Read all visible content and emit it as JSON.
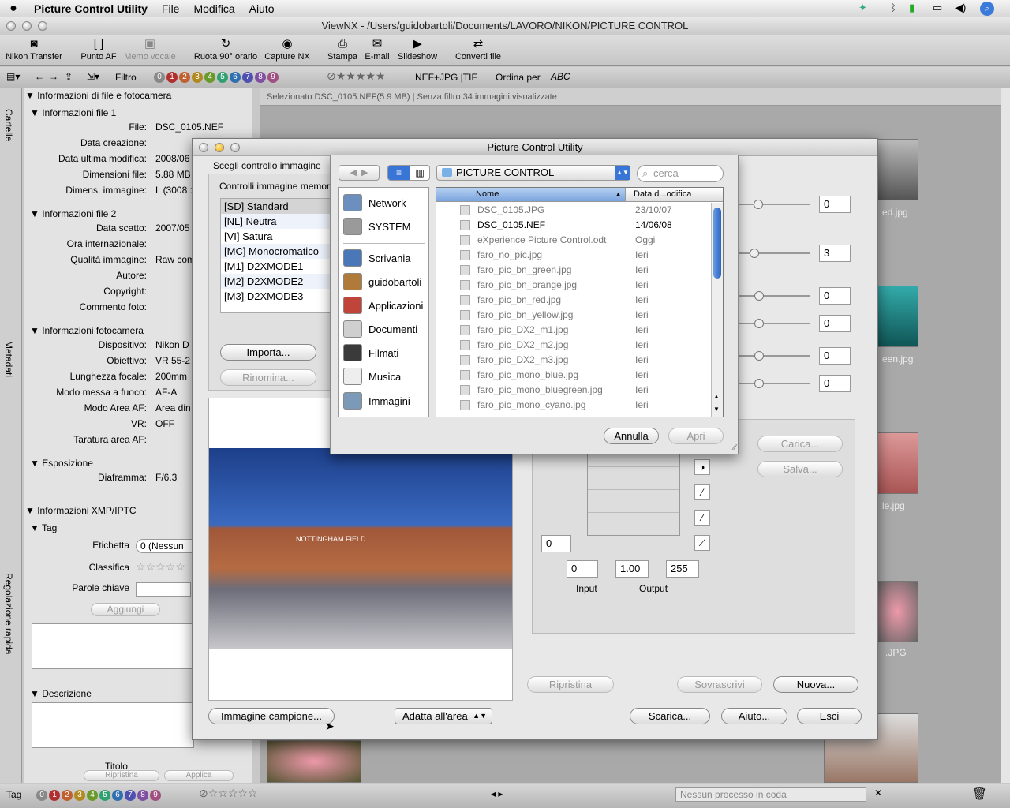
{
  "menubar": {
    "apple": "",
    "app": "Picture Control Utility",
    "items": [
      "File",
      "Modifica",
      "Aiuto"
    ]
  },
  "window": {
    "title": "ViewNX - /Users/guidobartoli/Documents/LAVORO/NIKON/PICTURE CONTROL"
  },
  "toolbar": {
    "items": [
      {
        "label": "Nikon Transfer",
        "icon": "camera-icon"
      },
      {
        "label": "Punto AF",
        "icon": "af-point-icon"
      },
      {
        "label": "Memo vocale",
        "icon": "voice-memo-icon"
      },
      {
        "label": "Ruota 90° orario",
        "icon": "rotate-icon"
      },
      {
        "label": "Capture NX",
        "icon": "capture-nx-icon"
      },
      {
        "label": "Stampa",
        "icon": "print-icon"
      },
      {
        "label": "E-mail",
        "icon": "mail-icon"
      },
      {
        "label": "Slideshow",
        "icon": "slideshow-icon"
      },
      {
        "label": "Converti file",
        "icon": "convert-icon"
      }
    ]
  },
  "filterbar": {
    "filtro": "Filtro",
    "dots": [
      "0",
      "1",
      "2",
      "3",
      "4",
      "5",
      "6",
      "7",
      "8",
      "9"
    ],
    "format": "NEF+JPG |TIF",
    "sort": "Ordina per",
    "sort_icon": "ABC"
  },
  "lefttabs": {
    "cartelle": "Cartelle",
    "metadati": "Metadati",
    "regolazione": "Regolazione rapida"
  },
  "info": {
    "header": "Informazioni di file e fotocamera",
    "file1": "Informazioni file 1",
    "file1_rows": [
      {
        "k": "File:",
        "v": "DSC_0105.NEF"
      },
      {
        "k": "Data creazione:",
        "v": ""
      },
      {
        "k": "Data ultima modifica:",
        "v": "2008/06"
      },
      {
        "k": "Dimensioni file:",
        "v": "5.88 MB"
      },
      {
        "k": "Dimens. immagine:",
        "v": "L (3008 :"
      }
    ],
    "file2": "Informazioni file 2",
    "file2_rows": [
      {
        "k": "Data scatto:",
        "v": "2007/05"
      },
      {
        "k": "Ora internazionale:",
        "v": ""
      },
      {
        "k": "Qualità immagine:",
        "v": "Raw com"
      },
      {
        "k": "Autore:",
        "v": ""
      },
      {
        "k": "Copyright:",
        "v": ""
      },
      {
        "k": "Commento foto:",
        "v": ""
      }
    ],
    "camera": "Informazioni fotocamera",
    "camera_rows": [
      {
        "k": "Dispositivo:",
        "v": "Nikon D"
      },
      {
        "k": "Obiettivo:",
        "v": "VR 55-2"
      },
      {
        "k": "Lunghezza focale:",
        "v": "200mm"
      },
      {
        "k": "Modo messa a fuoco:",
        "v": "AF-A"
      },
      {
        "k": "Modo Area AF:",
        "v": "Area din"
      },
      {
        "k": "VR:",
        "v": "OFF"
      },
      {
        "k": "Taratura area AF:",
        "v": ""
      }
    ],
    "exposure": "Esposizione",
    "exposure_rows": [
      {
        "k": "Diaframma:",
        "v": "F/6.3"
      }
    ]
  },
  "xmp": {
    "header": "Informazioni XMP/IPTC",
    "tag": "Tag",
    "etichetta": "Etichetta",
    "etichetta_value": "(Nessun",
    "etichetta_num": "0",
    "classifica": "Classifica",
    "parole": "Parole chiave",
    "aggiungi": "Aggiungi",
    "descrizione": "Descrizione",
    "titolo": "Titolo",
    "ripristina": "Ripristina",
    "applica": "Applica"
  },
  "main": {
    "header": "Selezionato:DSC_0105.NEF(5.9 MB) | Senza filtro:34 immagini visualizzate",
    "captions": [
      "ed.jpg",
      "een.jpg",
      "le.jpg",
      ".JPG"
    ]
  },
  "bottombar": {
    "tag": "Tag",
    "queue": "Nessun processo in coda"
  },
  "dialog": {
    "title": "Picture Control Utility",
    "choose": "Scegli controllo immagine",
    "memory": "Controlli immagine memor",
    "controls": [
      "[SD] Standard",
      "[NL] Neutra",
      "[VI] Satura",
      "[MC] Monocromatico",
      "[M1] D2XMODE1",
      "[M2] D2XMODE2",
      "[M3] D2XMODE3"
    ],
    "importa": "Importa...",
    "rinomina": "Rinomina...",
    "values": [
      "0",
      "3",
      "0",
      "0",
      "0",
      "0"
    ],
    "carica": "Carica...",
    "salva": "Salva...",
    "curve_field": "0",
    "input_val": "0",
    "gamma_val": "1.00",
    "output_val": "255",
    "input_label": "Input",
    "output_label": "Output",
    "ripristina": "Ripristina",
    "sovrascrivi": "Sovrascrivi",
    "nuova": "Nuova...",
    "campione": "Immagine campione...",
    "adatta": "Adatta all'area",
    "scarica": "Scarica...",
    "aiuto": "Aiuto...",
    "esci": "Esci",
    "photo_sign": "NOTTINGHAM FIELD"
  },
  "sheet": {
    "location": "PICTURE CONTROL",
    "search_placeholder": "cerca",
    "sidebar": [
      {
        "label": "Network",
        "icon": "network-icon",
        "color": "#6d8fc0"
      },
      {
        "label": "SYSTEM",
        "icon": "disk-icon",
        "color": "#9a9a9a"
      },
      {
        "label": "Scrivania",
        "icon": "desktop-icon",
        "color": "#4a77b8"
      },
      {
        "label": "guidobartoli",
        "icon": "home-icon",
        "color": "#b07a3a"
      },
      {
        "label": "Applicazioni",
        "icon": "applications-icon",
        "color": "#c0443a"
      },
      {
        "label": "Documenti",
        "icon": "documents-icon",
        "color": "#cfcfcf"
      },
      {
        "label": "Filmati",
        "icon": "movies-icon",
        "color": "#3a3a3a"
      },
      {
        "label": "Musica",
        "icon": "music-icon",
        "color": "#eeeeee"
      },
      {
        "label": "Immagini",
        "icon": "pictures-icon",
        "color": "#7a9ab8"
      }
    ],
    "col_name": "Nome",
    "col_date": "Data d...odifica",
    "files": [
      {
        "name": "DSC_0105.JPG",
        "date": "23/10/07",
        "enabled": false
      },
      {
        "name": "DSC_0105.NEF",
        "date": "14/06/08",
        "enabled": true
      },
      {
        "name": "eXperience Picture Control.odt",
        "date": "Oggi",
        "enabled": false
      },
      {
        "name": "faro_no_pic.jpg",
        "date": "Ieri",
        "enabled": false
      },
      {
        "name": "faro_pic_bn_green.jpg",
        "date": "Ieri",
        "enabled": false
      },
      {
        "name": "faro_pic_bn_orange.jpg",
        "date": "Ieri",
        "enabled": false
      },
      {
        "name": "faro_pic_bn_red.jpg",
        "date": "Ieri",
        "enabled": false
      },
      {
        "name": "faro_pic_bn_yellow.jpg",
        "date": "Ieri",
        "enabled": false
      },
      {
        "name": "faro_pic_DX2_m1.jpg",
        "date": "Ieri",
        "enabled": false
      },
      {
        "name": "faro_pic_DX2_m2.jpg",
        "date": "Ieri",
        "enabled": false
      },
      {
        "name": "faro_pic_DX2_m3.jpg",
        "date": "Ieri",
        "enabled": false
      },
      {
        "name": "faro_pic_mono_blue.jpg",
        "date": "Ieri",
        "enabled": false
      },
      {
        "name": "faro_pic_mono_bluegreen.jpg",
        "date": "Ieri",
        "enabled": false
      },
      {
        "name": "faro_pic_mono_cyano.jpg",
        "date": "Ieri",
        "enabled": false
      }
    ],
    "annulla": "Annulla",
    "apri": "Apri"
  },
  "colors": {
    "accent": "#3875d7",
    "selection": "#b5d5ff",
    "dot_colors": [
      "#888888",
      "#b03030",
      "#c06030",
      "#b08a20",
      "#6a9a2a",
      "#30a070",
      "#3070b0",
      "#5050b0",
      "#8050a0",
      "#a05080"
    ]
  }
}
